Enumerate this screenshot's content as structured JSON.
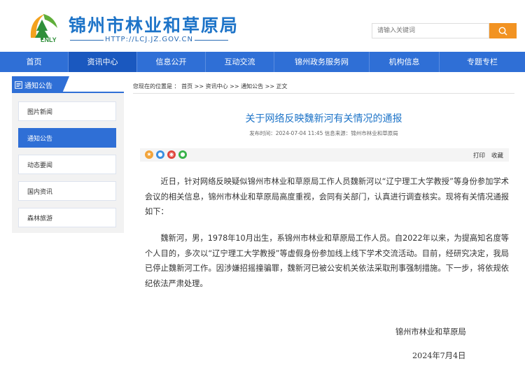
{
  "header": {
    "site_title": "锦州市林业和草原局",
    "site_url": "HTTP://LCJ.JZ.GOV.CN",
    "logo_letters": "LNLY",
    "search_placeholder": "请输入关键词"
  },
  "nav": {
    "items": [
      {
        "label": "首页"
      },
      {
        "label": "资讯中心"
      },
      {
        "label": "信息公开"
      },
      {
        "label": "互动交流"
      },
      {
        "label": "锦州政务服务网"
      },
      {
        "label": "机构信息"
      },
      {
        "label": "专题专栏"
      }
    ],
    "active_index": 1
  },
  "sidebar": {
    "heading": "通知公告",
    "items": [
      {
        "label": "图片新闻"
      },
      {
        "label": "通知公告"
      },
      {
        "label": "动态要闻"
      },
      {
        "label": "国内资讯"
      },
      {
        "label": "森林旅游"
      }
    ],
    "active_index": 1
  },
  "breadcrumb": {
    "text": "您现在的位置是 ： 首页 >> 资讯中心 >> 通知公告 >> 正文"
  },
  "article": {
    "title": "关于网络反映魏新河有关情况的通报",
    "meta": "发布时间：2024-07-04 11:45 信息来源：锦州市林业和草原局",
    "tools": {
      "print": "打印",
      "favorite": "收藏"
    },
    "paragraphs": [
      "近日，针对网络反映疑似锦州市林业和草原局工作人员魏新河以“辽宁理工大学教授”等身份参加学术会议的相关信息，锦州市林业和草原局高度重视，会同有关部门，认真进行调查核实。现将有关情况通报如下：",
      "魏新河，男，1978年10月出生，系锦州市林业和草原局工作人员。自2022年以来，为提高知名度等个人目的，多次以“辽宁理工大学教授”等虚假身份参加线上线下学术交流活动。目前，经研究决定，我局已停止魏新河工作。因涉嫌招摇撞骗罪，魏新河已被公安机关依法采取刑事强制措施。下一步，将依规依纪依法严肃处理。"
    ],
    "signature": "锦州市林业和草原局",
    "date": "2024年7月4日"
  },
  "colors": {
    "primary": "#2f6fd6",
    "title": "#1e74c8",
    "search_button": "#f29322"
  }
}
